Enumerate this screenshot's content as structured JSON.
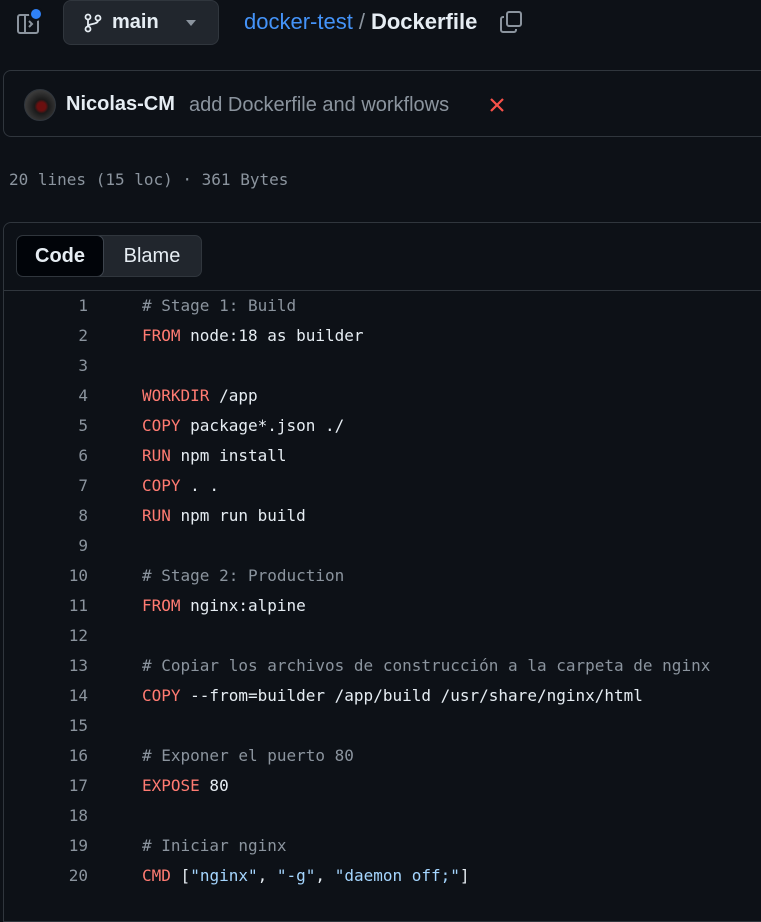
{
  "header": {
    "branch": "main",
    "repo": "docker-test",
    "separator": "/",
    "file": "Dockerfile"
  },
  "commit": {
    "author": "Nicolas-CM",
    "message": "add Dockerfile and workflows",
    "status_color": "#f85149"
  },
  "file_info": "20 lines (15 loc) · 361 Bytes",
  "tabs": {
    "code": "Code",
    "blame": "Blame"
  },
  "colors": {
    "keyword": "#ff7b72",
    "comment": "#8b949e",
    "string": "#a5d6ff",
    "link": "#4493f8"
  },
  "lines": [
    {
      "n": "1",
      "kw": "",
      "text": "# Stage 1: Build",
      "type": "comment"
    },
    {
      "n": "2",
      "kw": "FROM",
      "text": " node:18 as builder",
      "type": "code"
    },
    {
      "n": "3",
      "kw": "",
      "text": "",
      "type": "blank"
    },
    {
      "n": "4",
      "kw": "WORKDIR",
      "text": " /app",
      "type": "code"
    },
    {
      "n": "5",
      "kw": "COPY",
      "text": " package*.json ./",
      "type": "code"
    },
    {
      "n": "6",
      "kw": "RUN",
      "text": " npm install",
      "type": "code"
    },
    {
      "n": "7",
      "kw": "COPY",
      "text": " . .",
      "type": "code"
    },
    {
      "n": "8",
      "kw": "RUN",
      "text": " npm run build",
      "type": "code"
    },
    {
      "n": "9",
      "kw": "",
      "text": "",
      "type": "blank"
    },
    {
      "n": "10",
      "kw": "",
      "text": "# Stage 2: Production",
      "type": "comment"
    },
    {
      "n": "11",
      "kw": "FROM",
      "text": " nginx:alpine",
      "type": "code"
    },
    {
      "n": "12",
      "kw": "",
      "text": "",
      "type": "blank"
    },
    {
      "n": "13",
      "kw": "",
      "text": "# Copiar los archivos de construcción a la carpeta de nginx",
      "type": "comment"
    },
    {
      "n": "14",
      "kw": "COPY",
      "text": " --from=builder /app/build /usr/share/nginx/html",
      "type": "code"
    },
    {
      "n": "15",
      "kw": "",
      "text": "",
      "type": "blank"
    },
    {
      "n": "16",
      "kw": "",
      "text": "# Exponer el puerto 80",
      "type": "comment"
    },
    {
      "n": "17",
      "kw": "EXPOSE",
      "text": " 80",
      "type": "code"
    },
    {
      "n": "18",
      "kw": "",
      "text": "",
      "type": "blank"
    },
    {
      "n": "19",
      "kw": "",
      "text": "# Iniciar nginx",
      "type": "comment"
    },
    {
      "n": "20",
      "kw": "CMD",
      "text": "",
      "type": "cmd",
      "parts": [
        "[",
        "\"nginx\"",
        ", ",
        "\"-g\"",
        ", ",
        "\"daemon off;\"",
        "]"
      ]
    }
  ]
}
